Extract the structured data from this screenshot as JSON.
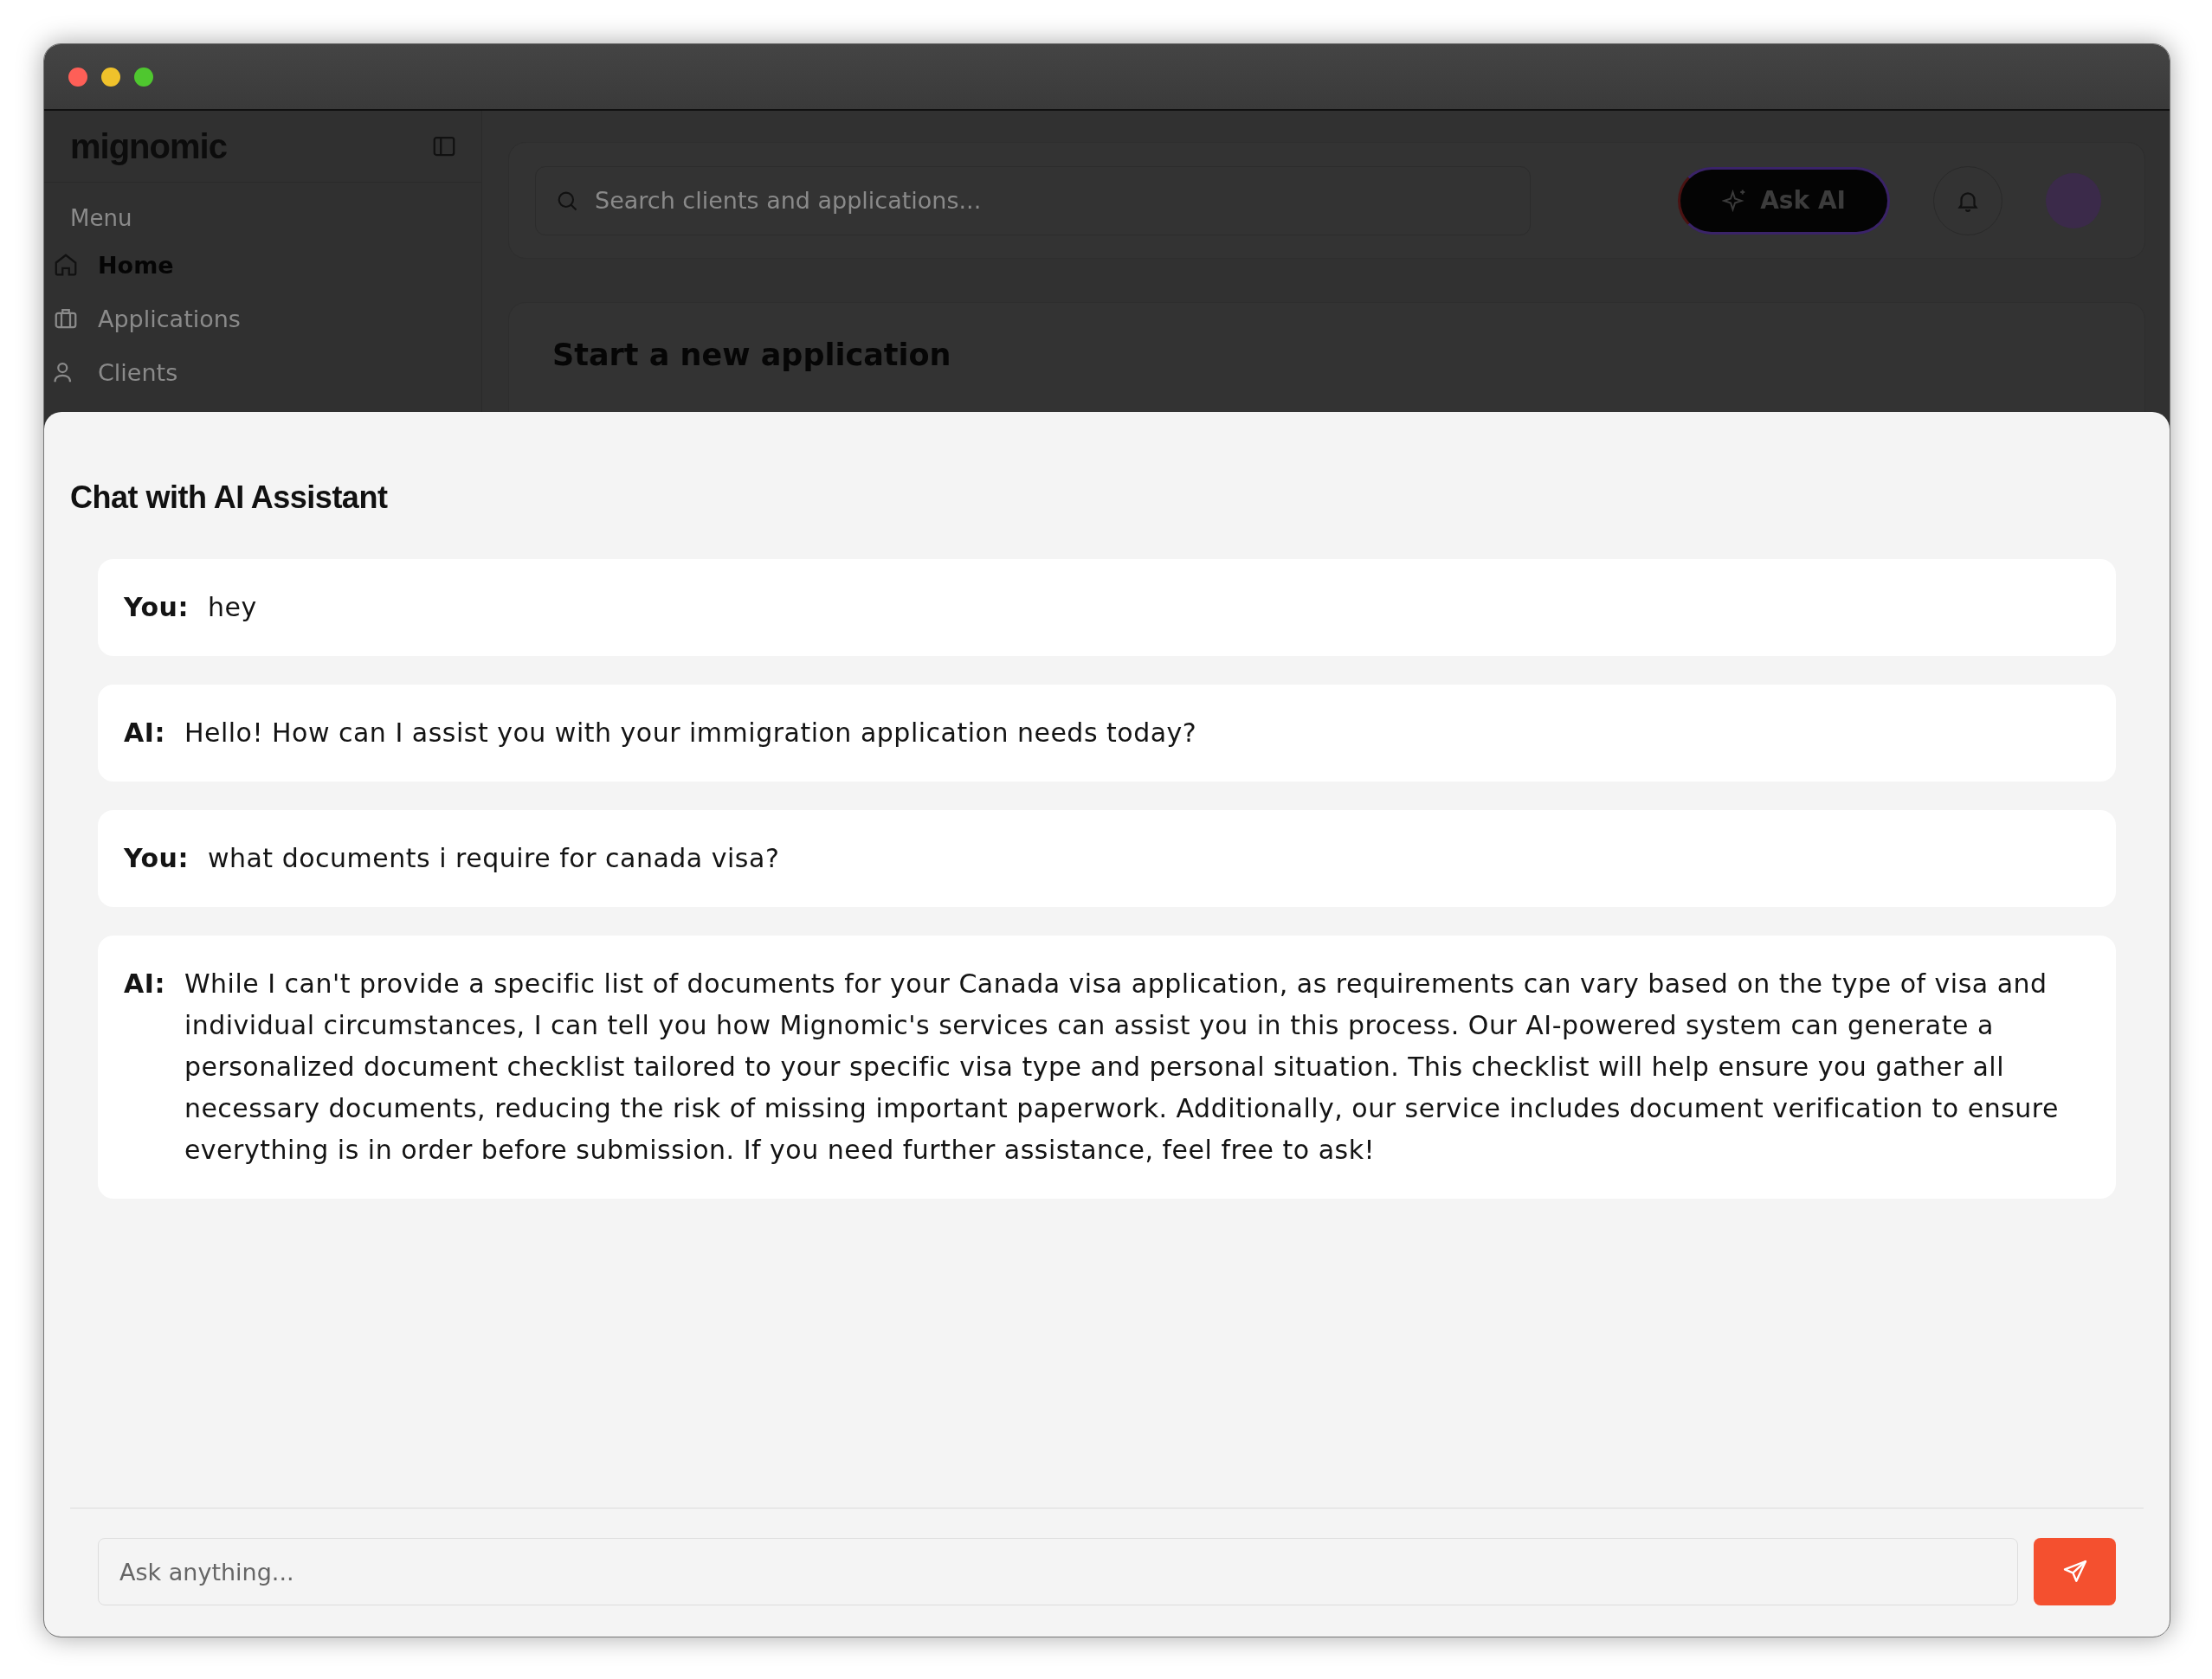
{
  "sidebar": {
    "logo": "mignomic",
    "section": "Menu",
    "items": [
      {
        "label": "Home",
        "selected": true
      },
      {
        "label": "Applications",
        "selected": false
      },
      {
        "label": "Clients",
        "selected": false
      }
    ]
  },
  "topbar": {
    "search": {
      "placeholder": "Search clients and applications..."
    },
    "ask_button": "Ask AI"
  },
  "main": {
    "heading": "Start a new application"
  },
  "chat": {
    "title": "Chat with AI Assistant",
    "messages": [
      {
        "sender": "You:",
        "text": "hey"
      },
      {
        "sender": "AI:",
        "text": "Hello! How can I assist you with your immigration application needs today?"
      },
      {
        "sender": "You:",
        "text": "what documents i require for canada visa?"
      },
      {
        "sender": "AI:",
        "text": "While I can't provide a specific list of documents for your Canada visa application, as requirements can vary based on the type of visa and individual circumstances, I can tell you how Mignomic's services can assist you in this process. Our AI-powered system can generate a personalized document checklist tailored to your specific visa type and personal situation. This checklist will help ensure you gather all necessary documents, reducing the risk of missing important paperwork. Additionally, our service includes document verification to ensure everything is in order before submission. If you need further assistance, feel free to ask!"
      }
    ],
    "input": {
      "placeholder": "Ask anything..."
    }
  }
}
